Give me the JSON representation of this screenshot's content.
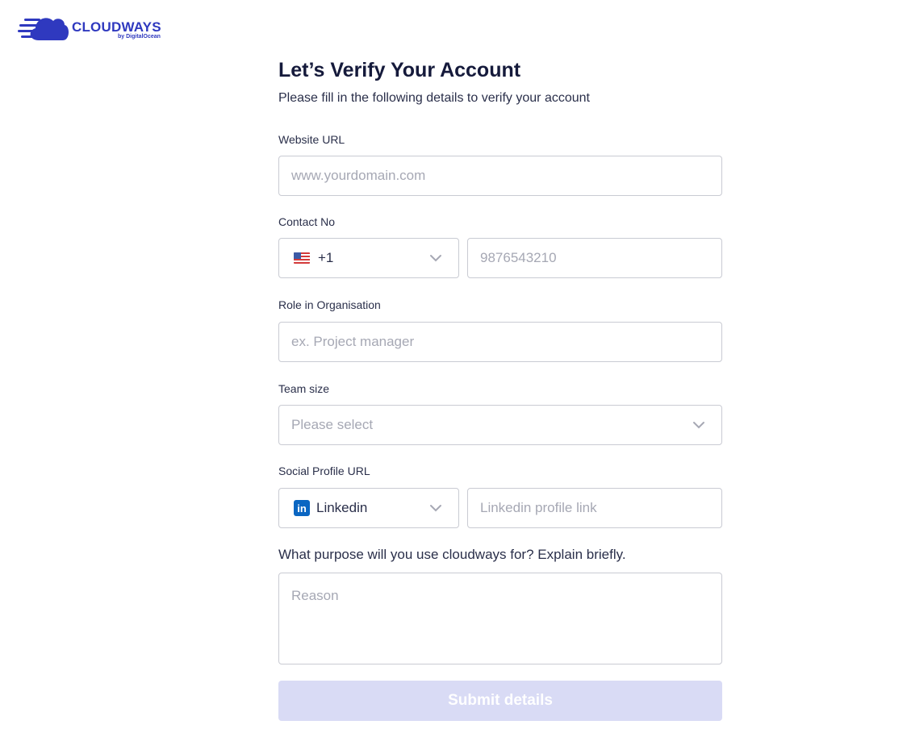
{
  "brand": {
    "name": "CLOUDWAYS",
    "byline": "by DigitalOcean",
    "color": "#2f39bf"
  },
  "header": {
    "title": "Let’s Verify Your Account",
    "subtitle": "Please fill in the following details to verify your account"
  },
  "fields": {
    "website": {
      "label": "Website URL",
      "placeholder": "www.yourdomain.com"
    },
    "contact": {
      "label": "Contact No",
      "country_code": "+1",
      "country_flag": "us-flag-icon",
      "placeholder": "9876543210"
    },
    "role": {
      "label": "Role in Organisation",
      "placeholder": "ex. Project manager"
    },
    "team_size": {
      "label": "Team size",
      "placeholder": "Please select"
    },
    "social": {
      "label": "Social Profile URL",
      "network": "Linkedin",
      "network_icon": "linkedin-icon",
      "placeholder": "Linkedin profile link"
    },
    "purpose": {
      "label": "What purpose will you use cloudways for? Explain briefly.",
      "placeholder": "Reason"
    }
  },
  "submit": {
    "label": "Submit details",
    "color": "#d9dbf5"
  }
}
